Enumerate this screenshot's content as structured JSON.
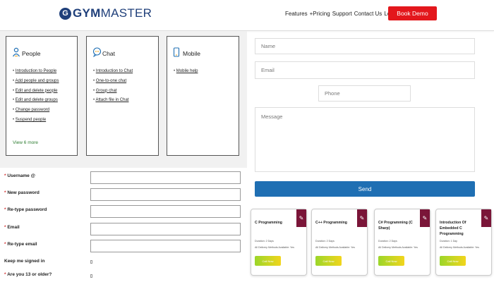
{
  "header": {
    "logo_gym": "GYM",
    "logo_master": "MASTER",
    "nav": [
      "Features",
      "+Pricing",
      "Support",
      "Contact Us",
      "Login"
    ],
    "book_demo": "Book Demo",
    "accent_color": "#e3171c",
    "brand_color": "#1f3f7a"
  },
  "help_cards": [
    {
      "title": "People",
      "icon": "person-icon",
      "links": [
        "Introduction to People",
        "Add people and groups",
        "Edit and delete people",
        "Edit and delete groups",
        "Change password",
        "Suspend people"
      ],
      "view_more": "View 6 more"
    },
    {
      "title": "Chat",
      "icon": "chat-bubble-icon",
      "links": [
        "Introduction to Chat",
        "One-to-one chat",
        "Group chat",
        "Attach file in Chat"
      ],
      "view_more": ""
    },
    {
      "title": "Mobile",
      "icon": "mobile-phone-icon",
      "links": [
        "Mobile help"
      ],
      "view_more": ""
    }
  ],
  "signup_form": {
    "fields": [
      {
        "label": "Username",
        "required": "*",
        "suffix": "@"
      },
      {
        "label": "New password",
        "required": "*",
        "suffix": ""
      },
      {
        "label": "Re-type password",
        "required": "*",
        "suffix": ""
      },
      {
        "label": "Email",
        "required": "*",
        "suffix": ""
      },
      {
        "label": "Re-type email",
        "required": "*",
        "suffix": ""
      }
    ],
    "keep_signed_in": "Keep me signed in",
    "age_question": "Are you 13 or older?",
    "age_required": "*"
  },
  "contact_form": {
    "name_placeholder": "Name",
    "email_placeholder": "Email",
    "phone_placeholder": "Phone",
    "message_placeholder": "Message",
    "send_label": "Send"
  },
  "courses": [
    {
      "title": "C Programming",
      "duration": "Duration: 2 Days",
      "delivery": "All Delivery Methods Available: Yes",
      "button": "Call Now"
    },
    {
      "title": "C++ Programming",
      "duration": "Duration: 2 Days",
      "delivery": "All Delivery Methods Available: Yes",
      "button": "Call Now"
    },
    {
      "title": "C# Programming (C Sharp)",
      "duration": "Duration: 2 Days",
      "delivery": "All Delivery Methods Available: Yes",
      "button": "Call Now"
    },
    {
      "title": "Introduction Of Embedded C Programming",
      "duration": "Duration: 1 Day",
      "delivery": "All Delivery Methods Available: Yes",
      "button": "Call Now"
    }
  ]
}
